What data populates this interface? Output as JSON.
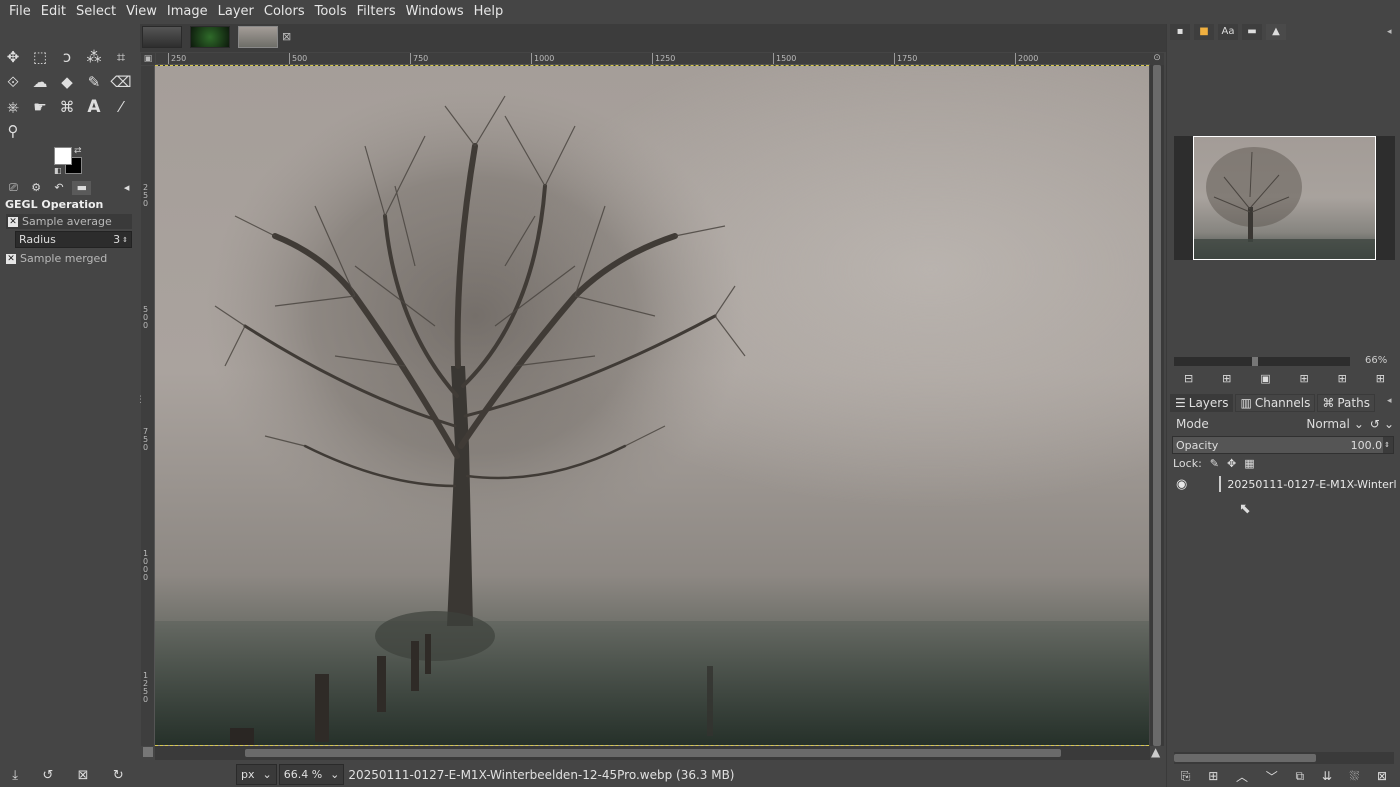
{
  "menubar": {
    "items": [
      "File",
      "Edit",
      "Select",
      "View",
      "Image",
      "Layer",
      "Colors",
      "Tools",
      "Filters",
      "Windows",
      "Help"
    ]
  },
  "toolbox": {
    "tools": [
      {
        "name": "move-tool-icon",
        "glyph": "✥"
      },
      {
        "name": "rect-select-icon",
        "glyph": "⬚"
      },
      {
        "name": "free-select-icon",
        "glyph": "ↄ"
      },
      {
        "name": "fuzzy-select-icon",
        "glyph": "⁂"
      },
      {
        "name": "crop-icon",
        "glyph": "⌗"
      },
      {
        "name": "unified-transform-icon",
        "glyph": "⟐"
      },
      {
        "name": "warp-icon",
        "glyph": "☁"
      },
      {
        "name": "bucket-fill-icon",
        "glyph": "◆"
      },
      {
        "name": "paintbrush-icon",
        "glyph": "✎"
      },
      {
        "name": "eraser-icon",
        "glyph": "⌫"
      },
      {
        "name": "clone-icon",
        "glyph": "⎈"
      },
      {
        "name": "smudge-icon",
        "glyph": "☛"
      },
      {
        "name": "paths-icon",
        "glyph": "⌘"
      },
      {
        "name": "text-tool-icon",
        "glyph": "A"
      },
      {
        "name": "color-picker-icon",
        "glyph": "⁄"
      },
      {
        "name": "zoom-icon",
        "glyph": "⚲"
      }
    ],
    "bottom_buttons": [
      "⤓",
      "↺",
      "⊠",
      "↻"
    ]
  },
  "tool_options": {
    "title": "GEGL Operation",
    "sample_average_label": "Sample average",
    "radius_label": "Radius",
    "radius_value": "3",
    "sample_merged_label": "Sample merged"
  },
  "ruler": {
    "h_labels": [
      "250",
      "500",
      "750",
      "1000",
      "1250",
      "1500",
      "1750",
      "2000"
    ],
    "v_labels": [
      "2 5 0",
      "5 0 0",
      "7 5 0",
      "1 0 0 0",
      "1 2 5 0"
    ]
  },
  "statusbar": {
    "unit": "px",
    "zoom": "66.4 %",
    "filename": "20250111-0127-E-M1X-Winterbeelden-12-45Pro.webp (36.3 MB)"
  },
  "navigator": {
    "zoom_label": "66%",
    "zoom_level": 0.66
  },
  "layers_panel": {
    "tabs": [
      "Layers",
      "Channels",
      "Paths"
    ],
    "mode_label": "Mode",
    "mode_value": "Normal",
    "opacity_label": "Opacity",
    "opacity_value": "100.0",
    "lock_label": "Lock:",
    "layer_name": "20250111-0127-E-M1X-Winterl"
  },
  "colors": {
    "foreground": "#ffffff",
    "background": "#000000",
    "selection_border": "#d8c84c"
  }
}
